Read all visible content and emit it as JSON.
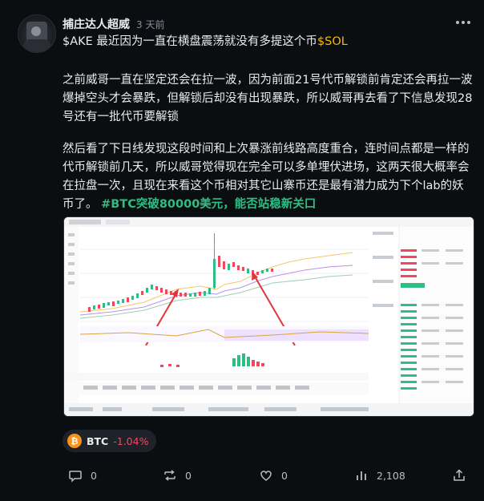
{
  "post": {
    "username": "捕庄达人超威",
    "time_ago": "3 天前",
    "line1_pre": "$AKE 最近因为一直在横盘震荡就没有多提这个币",
    "line1_cash": "$SOL",
    "para2": "之前威哥一直在坚定还会在拉一波，因为前面21号代币解锁前肯定还会再拉一波爆掉空头才会暴跌，但解锁后却没有出现暴跌，所以威哥再去看了下信息发现28号还有一批代币要解锁",
    "para3": "然后看了下日线发现这段时间和上次暴涨前线路高度重合，连时间点都是一样的代币解锁前几天，所以威哥觉得现在完全可以多单埋伏进场，这两天很大概率会在拉盘一次，且现在来看这个币相对其它山寨币还是最有潜力成为下个lab的妖币了。",
    "hashtag": "#BTC突破80000美元，能否站稳新关口"
  },
  "coin": {
    "symbol": "BTC",
    "change": "-1.04%",
    "icon_glyph": "₿",
    "icon_color": "#f7931a"
  },
  "actions": {
    "reply_count": "0",
    "repost_count": "0",
    "like_count": "0",
    "views_count": "2,108"
  },
  "icons": {
    "more": "more-dots-icon",
    "reply": "comment-icon",
    "repost": "repost-icon",
    "like": "heart-icon",
    "views": "bar-chart-icon",
    "share": "share-icon"
  },
  "colors": {
    "background": "#0b0e11",
    "text": "#eaecef",
    "muted": "#848e9c",
    "cashtag": "#f0b90b",
    "hashtag": "#2ebd85",
    "negative": "#f6465d"
  }
}
